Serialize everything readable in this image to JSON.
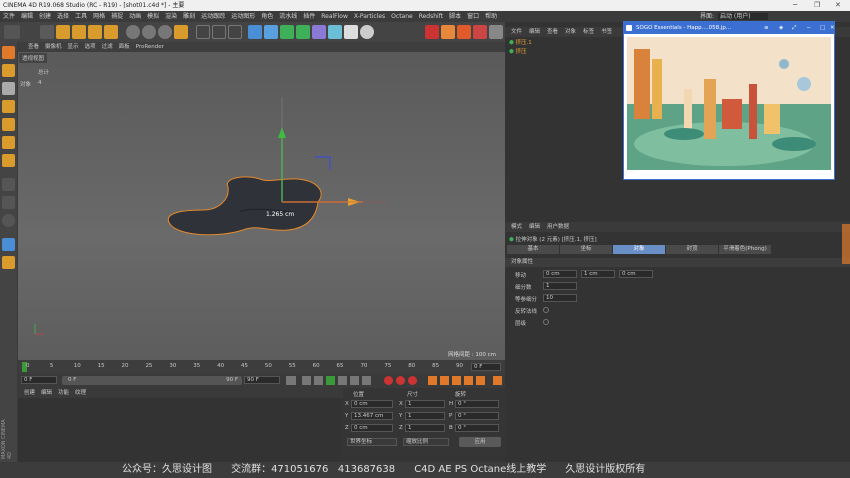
{
  "window": {
    "title": "CINEMA 4D R19.068 Studio (RC - R19) - [shot01.c4d *] - 主要"
  },
  "menubar": {
    "items": [
      "文件",
      "编辑",
      "创建",
      "选择",
      "工具",
      "网格",
      "捕捉",
      "动画",
      "模拟",
      "渲染",
      "雕刻",
      "运动跟踪",
      "运动图形",
      "角色",
      "流水线",
      "插件",
      "RealFlow",
      "X-Particles",
      "Octane",
      "Redshift",
      "脚本",
      "窗口",
      "帮助"
    ],
    "layout_label": "界面:",
    "layout_value": "启动 (用户)"
  },
  "viewport": {
    "menu": [
      "查看",
      "摄像机",
      "显示",
      "选项",
      "过滤",
      "面板",
      "ProRender"
    ],
    "name": "透视视图",
    "hud_label_total": "总计",
    "hud_label_objects": "对象",
    "hud_objects_value": "4",
    "measure": "1.265 cm",
    "grid_spacing": "网格间距 : 100 cm"
  },
  "timeline": {
    "ticks": [
      "0",
      "5",
      "10",
      "15",
      "20",
      "25",
      "30",
      "35",
      "40",
      "45",
      "50",
      "55",
      "60",
      "65",
      "70",
      "75",
      "80",
      "85",
      "90"
    ],
    "current": "0 F",
    "start": "0 F",
    "end": "90 F",
    "range_end": "90 F",
    "range_start": "0 F"
  },
  "material": {
    "menu": [
      "创建",
      "编辑",
      "功能",
      "纹理"
    ]
  },
  "coords": {
    "headers": [
      "位置",
      "尺寸",
      "旋转"
    ],
    "rows": [
      {
        "a": "X",
        "pos": "0 cm",
        "b": "X",
        "size": "1",
        "c": "H",
        "rot": "0 °"
      },
      {
        "a": "Y",
        "pos": "13.467 cm",
        "b": "Y",
        "size": "1",
        "c": "P",
        "rot": "0 °"
      },
      {
        "a": "Z",
        "pos": "0 cm",
        "b": "Z",
        "size": "1",
        "c": "B",
        "rot": "0 °"
      }
    ],
    "mode1": "世界坐标",
    "mode2": "缩放比例",
    "apply": "应用"
  },
  "objects": {
    "menu": [
      "文件",
      "编辑",
      "查看",
      "对象",
      "标签",
      "书签"
    ],
    "items": [
      "挤压.1",
      "挤压"
    ]
  },
  "attributes": {
    "menu": [
      "模式",
      "编辑",
      "用户数据"
    ],
    "title": "拉伸对象 (2 元素) [挤压.1, 挤压]",
    "tabs": [
      "基本",
      "坐标",
      "对象",
      "封顶",
      "平滑着色(Phong)"
    ],
    "active_tab": "对象",
    "section": "对象属性",
    "props": [
      {
        "label": "移动",
        "values": [
          "0 cm",
          "1 cm",
          "0 cm"
        ]
      },
      {
        "label": "细分数",
        "values": [
          "1"
        ]
      },
      {
        "label": "等参细分",
        "values": [
          "10"
        ]
      },
      {
        "label": "反转法线",
        "values": []
      },
      {
        "label": "层级",
        "values": []
      }
    ]
  },
  "sogo": {
    "title": "SOGO Essentials - Happ....058.jp..."
  },
  "footer": {
    "text": "公众号：久思设计图      交流群：471051676   413687638      C4D AE PS Octane线上教学      久思设计版权所有"
  },
  "brand": {
    "vertical": "MAXON CINEMA 4D"
  }
}
